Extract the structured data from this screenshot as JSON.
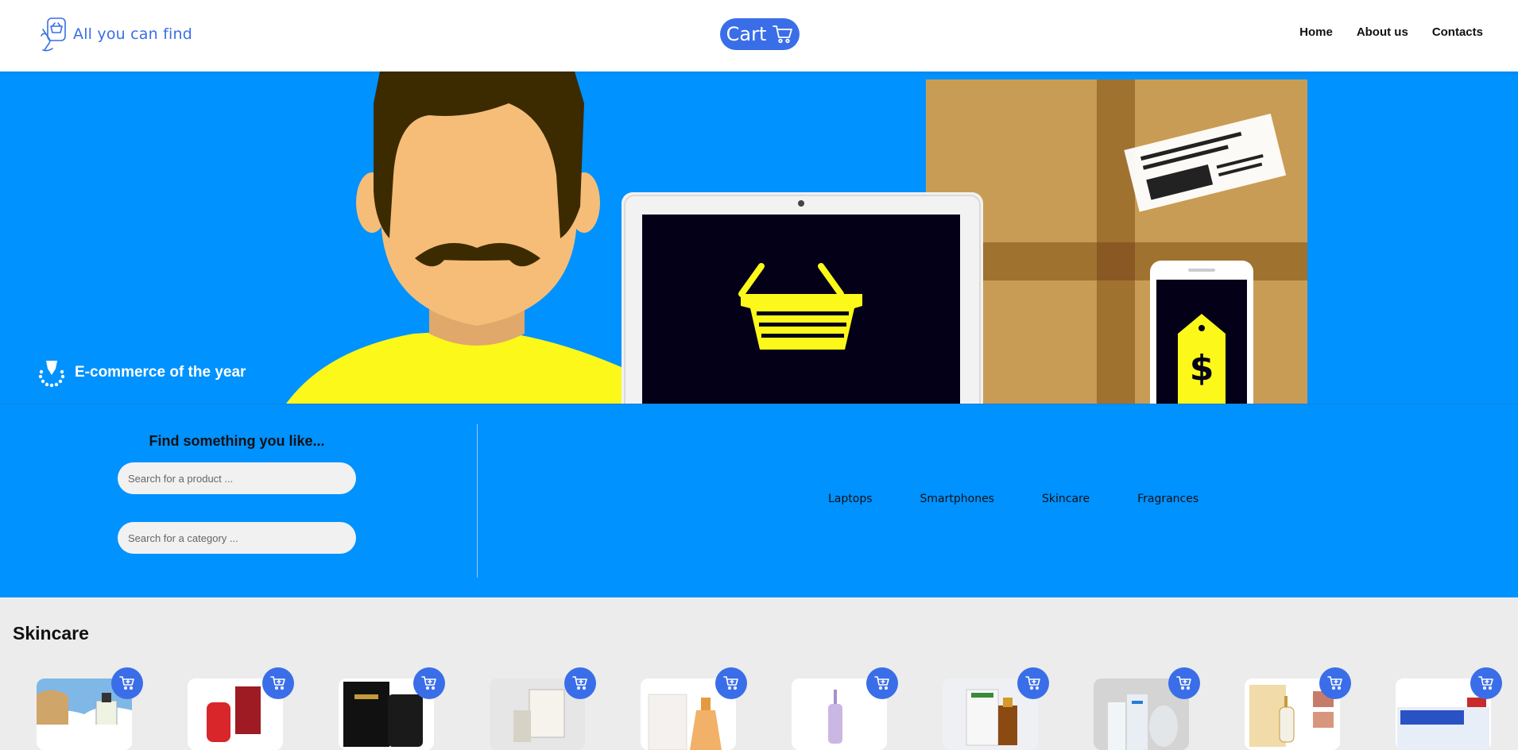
{
  "header": {
    "logo_text": "All you can find",
    "cart_label": "Cart",
    "nav": [
      {
        "label": "Home"
      },
      {
        "label": "About us"
      },
      {
        "label": "Contacts"
      }
    ]
  },
  "hero": {
    "award_text": "E-commerce of the year"
  },
  "search": {
    "title": "Find something you like...",
    "product_placeholder": "Search for a product ...",
    "category_placeholder": "Search for a category ..."
  },
  "categories": [
    {
      "label": "Laptops"
    },
    {
      "label": "Smartphones"
    },
    {
      "label": "Skincare"
    },
    {
      "label": "Fragrances"
    }
  ],
  "section": {
    "title": "Skincare"
  },
  "colors": {
    "accent": "#3a6ee8",
    "hero_bg": "#0092ff",
    "page_bg": "#ececec"
  }
}
